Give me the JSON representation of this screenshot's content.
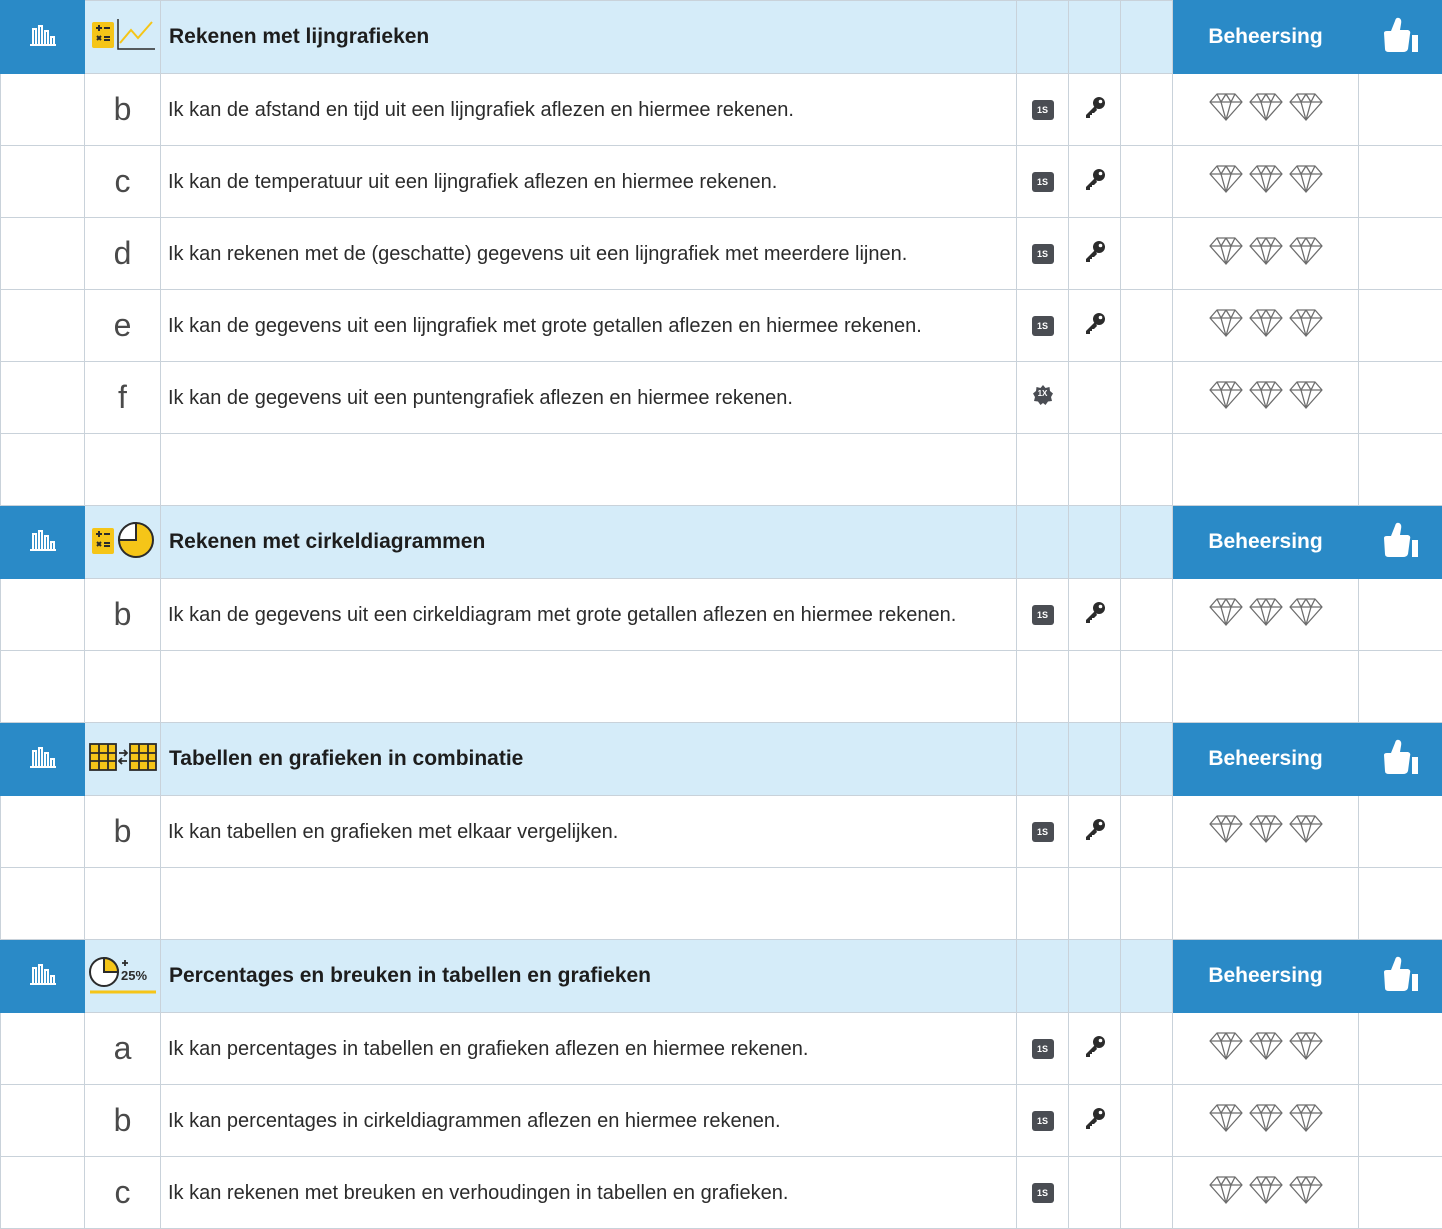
{
  "mastery_label": "Beheersing",
  "sections": [
    {
      "title": "Rekenen met lijngrafieken",
      "icon": "calc-linegraph-icon",
      "goals": [
        {
          "letter": "b",
          "text": "Ik kan de afstand en tijd uit een lijngrafiek aflezen en hiermee rekenen.",
          "badge": "1S",
          "key": true
        },
        {
          "letter": "c",
          "text": "Ik kan de temperatuur uit een lijngrafiek aflezen en hiermee rekenen.",
          "badge": "1S",
          "key": true
        },
        {
          "letter": "d",
          "text": "Ik kan rekenen met de (geschatte) gegevens uit een lijngrafiek met meerdere lijnen.",
          "badge": "1S",
          "key": true
        },
        {
          "letter": "e",
          "text": "Ik kan de gegevens uit een lijngrafiek met grote getallen aflezen en hiermee rekenen.",
          "badge": "1S",
          "key": true
        },
        {
          "letter": "f",
          "text": "Ik kan de gegevens uit een puntengrafiek aflezen en hiermee rekenen.",
          "badge": "1X",
          "key": false
        }
      ]
    },
    {
      "title": "Rekenen met cirkeldiagrammen",
      "icon": "calc-piechart-icon",
      "goals": [
        {
          "letter": "b",
          "text": "Ik kan de gegevens uit een cirkeldiagram met grote getallen aflezen en hiermee rekenen.",
          "badge": "1S",
          "key": true
        }
      ]
    },
    {
      "title": "Tabellen en grafieken in combinatie",
      "icon": "table-compare-icon",
      "goals": [
        {
          "letter": "b",
          "text": "Ik kan tabellen en grafieken met elkaar vergelijken.",
          "badge": "1S",
          "key": true
        }
      ]
    },
    {
      "title": "Percentages en breuken in tabellen en grafieken",
      "icon": "pie-percent-icon",
      "icon_text": "25%",
      "goals": [
        {
          "letter": "a",
          "text": "Ik kan percentages in tabellen en grafieken aflezen en hiermee rekenen.",
          "badge": "1S",
          "key": true
        },
        {
          "letter": "b",
          "text": "Ik kan percentages in cirkeldiagrammen aflezen en hiermee rekenen.",
          "badge": "1S",
          "key": true
        },
        {
          "letter": "c",
          "text": "Ik kan rekenen met breuken en verhoudingen in tabellen en grafieken.",
          "badge": "1S",
          "key": false
        }
      ]
    }
  ],
  "colors": {
    "header_blue": "#2a8ac7",
    "header_light": "#d5ecf9",
    "icon_yellow": "#f5c518"
  }
}
